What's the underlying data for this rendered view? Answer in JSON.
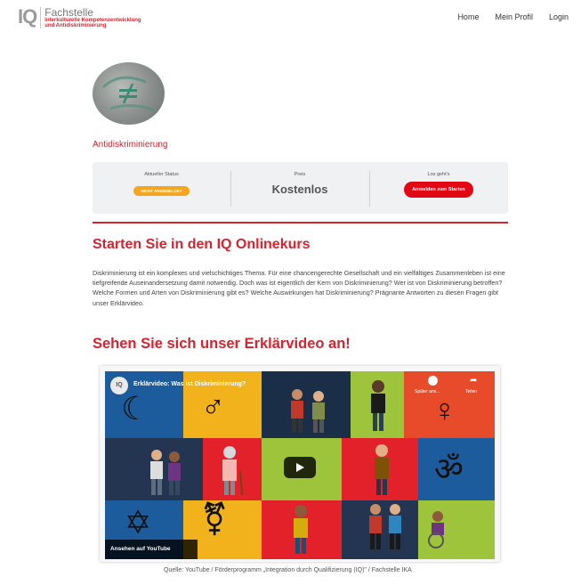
{
  "header": {
    "logo_iq": "IQ",
    "logo_title": "Fachstelle",
    "logo_subtitle_1": "Interkulturelle Kompetenzentwicklung",
    "logo_subtitle_2": "und Antidiskriminierung",
    "nav": [
      "Home",
      "Mein Profil",
      "Login"
    ]
  },
  "course": {
    "name": "Antidiskriminierung",
    "status_label": "Aktueller Status",
    "status_value": "NICHT ANGEMELDET",
    "price_label": "Preis",
    "price_value": "Kostenlos",
    "cta_label": "Los geht's",
    "cta_button": "Anmelden zum Starten"
  },
  "intro": {
    "heading": "Starten Sie in den IQ Onlinekurs",
    "text": "Diskriminierung ist ein komplexes und vielschichtiges Thema. Für eine chancengerechte Gesellschaft und ein vielfältiges Zusammenleben ist eine tiefgreifende Auseinandersetzung damit notwendig. Doch was ist eigentlich der Kern von Diskriminierung? Wer ist von Diskriminierung betroffen? Welche Formen und Arten von Diskriminierung gibt es? Welche Auswirkungen hat Diskriminierung? Prägnante Antworten zu diesen Fragen gibt unser Erklärvideo."
  },
  "video_section": {
    "heading": "Sehen Sie sich unser Erklärvideo an!",
    "video_title": "Erklärvideo: Was ist Diskriminierung?",
    "channel_logo": "IQ",
    "watch_later": "Später ans...",
    "share": "Teilen",
    "watch_on": "Ansehen auf  YouTube",
    "source": "Quelle: YouTube / Förderprogramm „Integration durch Qualifizierung (IQ)\" / Fachstelle IKA"
  },
  "colors": {
    "brand_red": "#d3242f",
    "badge_orange": "#f4a623",
    "button_red": "#e30613"
  }
}
